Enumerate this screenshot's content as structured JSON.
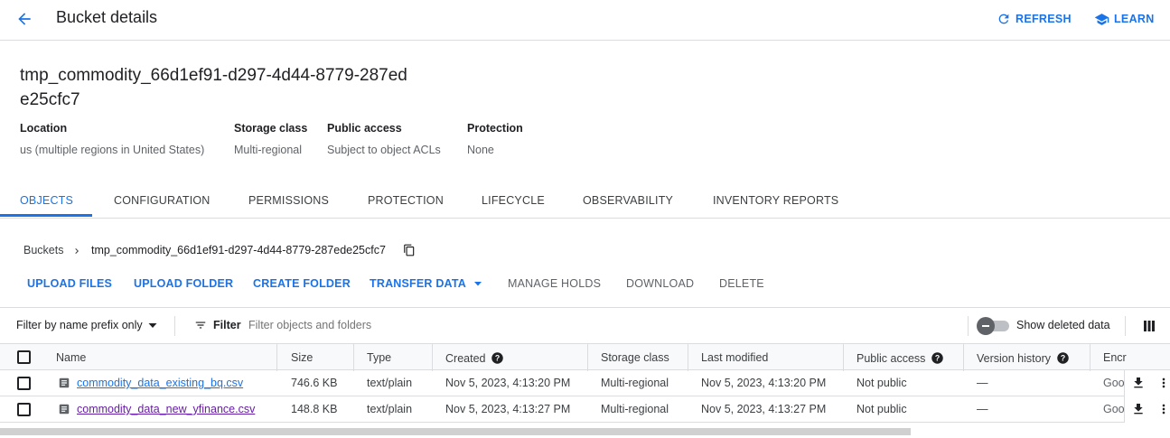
{
  "header": {
    "title": "Bucket details",
    "refresh_label": "REFRESH",
    "learn_label": "LEARN"
  },
  "bucket": {
    "name": "tmp_commodity_66d1ef91-d297-4d44-8779-287ede25cfc7",
    "meta": [
      {
        "label": "Location",
        "value": "us (multiple regions in United States)"
      },
      {
        "label": "Storage class",
        "value": "Multi-regional"
      },
      {
        "label": "Public access",
        "value": "Subject to object ACLs"
      },
      {
        "label": "Protection",
        "value": "None"
      }
    ]
  },
  "tabs": [
    "OBJECTS",
    "CONFIGURATION",
    "PERMISSIONS",
    "PROTECTION",
    "LIFECYCLE",
    "OBSERVABILITY",
    "INVENTORY REPORTS"
  ],
  "active_tab": "OBJECTS",
  "breadcrumb": {
    "root": "Buckets",
    "current": "tmp_commodity_66d1ef91-d297-4d44-8779-287ede25cfc7"
  },
  "actions": {
    "upload_files": "UPLOAD FILES",
    "upload_folder": "UPLOAD FOLDER",
    "create_folder": "CREATE FOLDER",
    "transfer_data": "TRANSFER DATA",
    "manage_holds": "MANAGE HOLDS",
    "download": "DOWNLOAD",
    "delete": "DELETE"
  },
  "filter": {
    "mode": "Filter by name prefix only",
    "label": "Filter",
    "placeholder": "Filter objects and folders",
    "show_deleted": "Show deleted data",
    "show_deleted_on": false
  },
  "table": {
    "columns": [
      "Name",
      "Size",
      "Type",
      "Created",
      "Storage class",
      "Last modified",
      "Public access",
      "Version history",
      "Encr"
    ],
    "rows": [
      {
        "name": "commodity_data_existing_bq.csv",
        "size": "746.6 KB",
        "type": "text/plain",
        "created": "Nov 5, 2023, 4:13:20 PM",
        "storage_class": "Multi-regional",
        "last_modified": "Nov 5, 2023, 4:13:20 PM",
        "public_access": "Not public",
        "version_history": "—",
        "encryption": "Goo"
      },
      {
        "name": "commodity_data_new_yfinance.csv",
        "size": "148.8 KB",
        "type": "text/plain",
        "created": "Nov 5, 2023, 4:13:27 PM",
        "storage_class": "Multi-regional",
        "last_modified": "Nov 5, 2023, 4:13:27 PM",
        "public_access": "Not public",
        "version_history": "—",
        "encryption": "Goo"
      }
    ]
  },
  "colors": {
    "accent": "#1a73e8",
    "visited_link": "#681da8"
  }
}
